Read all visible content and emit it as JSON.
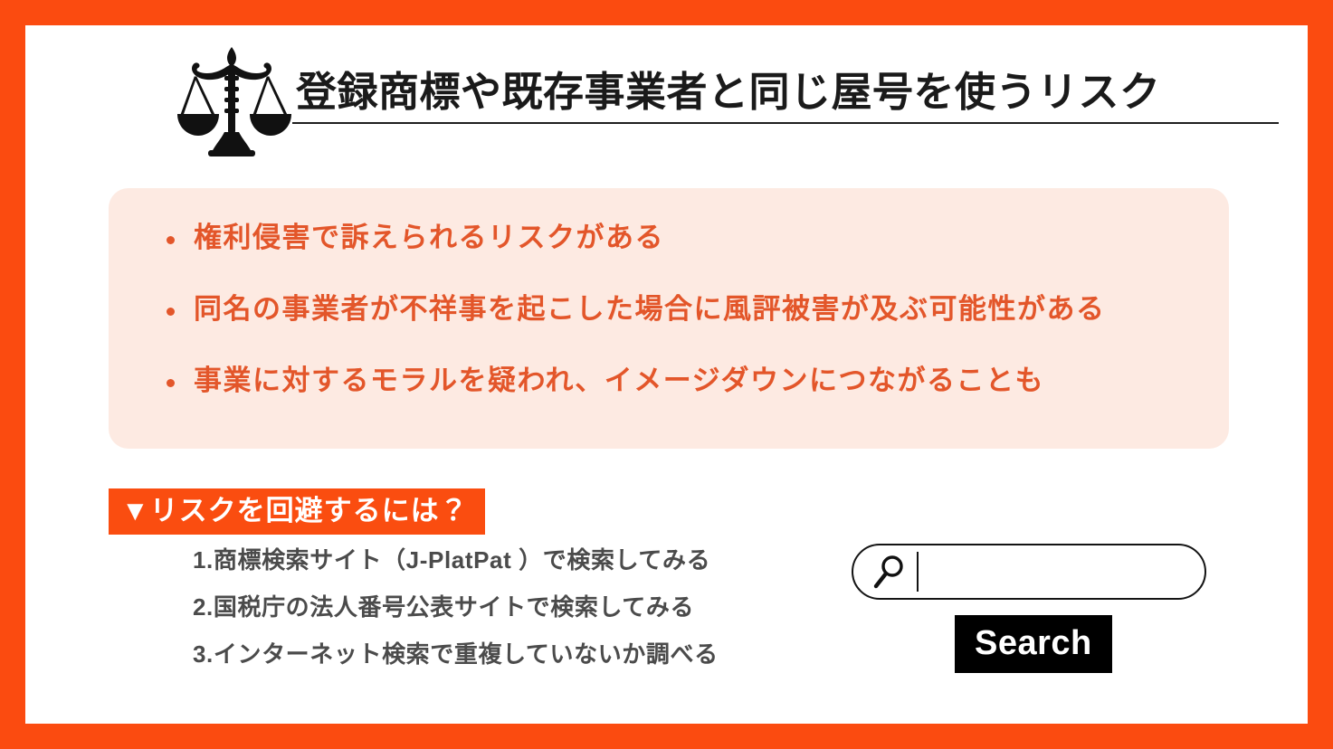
{
  "theme": {
    "frame_orange": "#FB4B10",
    "card_peach": "#FDEAE2",
    "risk_text_orange": "#E3562A",
    "banner_orange": "#FA4D10",
    "step_gray": "#4B4B4B",
    "title_black": "#1A1A1A",
    "button_black": "#000000"
  },
  "header": {
    "icon": "balance-scale-icon",
    "title": "登録商標や既存事業者と同じ屋号を使うリスク"
  },
  "risks": {
    "items": [
      "権利侵害で訴えられるリスクがある",
      "同名の事業者が不祥事を起こした場合に風評被害が及ぶ可能性がある",
      "事業に対するモラルを疑われ、イメージダウンにつながることも"
    ]
  },
  "banner": {
    "label": "▼リスクを回避するには？"
  },
  "steps": {
    "items": [
      "1.商標検索サイト（J-PlatPat ）で検索してみる",
      "2.国税庁の法人番号公表サイトで検索してみる",
      "3.インターネット検索で重複していないか調べる"
    ]
  },
  "search": {
    "icon": "magnifier-icon",
    "value": "",
    "placeholder": "",
    "button_label": "Search"
  }
}
